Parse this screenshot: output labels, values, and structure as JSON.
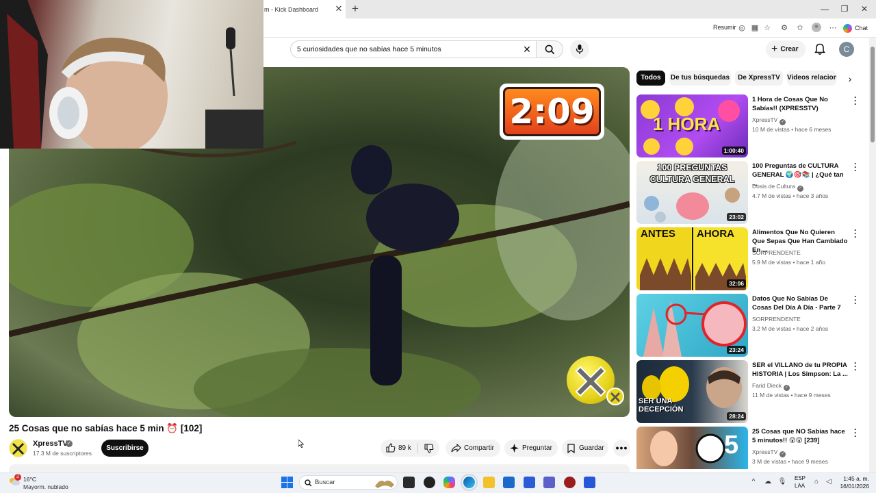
{
  "browser": {
    "tab_title": "m - Kick Dashboard",
    "tab_close": "✕",
    "new_tab": "+",
    "toolbar_resumir": "Resumir",
    "chat_label": "Chat"
  },
  "youtube": {
    "search_value": "5 curiosidades que no sabías hace 5 minutos",
    "create_label": "Crear",
    "user_initial": "C"
  },
  "player": {
    "timer_text": "2:09"
  },
  "video": {
    "title": "25 Cosas que no sabías hace 5 min ⏰ [102]",
    "channel_name": "XpressTV",
    "subscribers": "17.3 M de suscriptores",
    "subscribe_label": "Suscribirse",
    "likes": "89 k",
    "share_label": "Compartir",
    "ask_label": "Preguntar",
    "save_label": "Guardar",
    "more_label": "•••"
  },
  "chips": [
    {
      "label": "Todos"
    },
    {
      "label": "De tus búsquedas"
    },
    {
      "label": "De XpressTV"
    },
    {
      "label": "Videos relacion"
    }
  ],
  "recommendations": [
    {
      "title": "1 Hora de Cosas Que No Sabías!! (XPRESSTV)",
      "channel": "XpressTV",
      "views": "10 M de vistas • hace 6 meses",
      "duration": "1:00:40",
      "thumb_text": "1 HORA"
    },
    {
      "title": "100 Preguntas de CULTURA GENERAL 🌍🎯📚 | ¿Qué tan ...",
      "channel": "Dosis de Cultura",
      "views": "4.7 M de vistas • hace 3 años",
      "duration": "23:02",
      "thumb_text": "100 PREGUNTAS CULTURA GENERAL"
    },
    {
      "title": "Alimentos Que No Quieren Que Sepas Que Han Cambiado En ...",
      "channel": "SORPRENDENTE",
      "views": "5.9 M de vistas • hace 1 año",
      "duration": "32:06",
      "thumb_text_a": "ANTES",
      "thumb_text_b": "AHORA"
    },
    {
      "title": "Datos Que No Sabías De Cosas Del Día A Día - Parte 7",
      "channel": "SORPRENDENTE",
      "views": "3.2 M de vistas • hace 2 años",
      "duration": "23:24"
    },
    {
      "title": "SER el VILLANO de tu PROPIA HISTORIA | Los Simpson: La ...",
      "channel": "Farid Dieck",
      "views": "11 M de vistas • hace 9 meses",
      "duration": "28:24",
      "thumb_text": "SER UNA DECEPCIÓN"
    },
    {
      "title": "25 Cosas que NO Sabías hace 5 minutos!! 😲😲 [239]",
      "channel": "XpressTV",
      "views": "3 M de vistas • hace 9 meses",
      "thumb_text": "5"
    }
  ],
  "taskbar": {
    "weather_badge": "2",
    "temperature": "16°C",
    "weather_desc": "Mayorm. nublado",
    "search_label": "Buscar",
    "lang_top": "ESP",
    "lang_bottom": "LAA",
    "time": "1:45 a. m.",
    "date": "16/01/2026"
  },
  "colors": {
    "youtube_red": "#ff0000",
    "subscribe_bg": "#0f0f0f",
    "timer_orange": "#ff8a1e",
    "x_badge_yellow": "#e5d21a"
  }
}
